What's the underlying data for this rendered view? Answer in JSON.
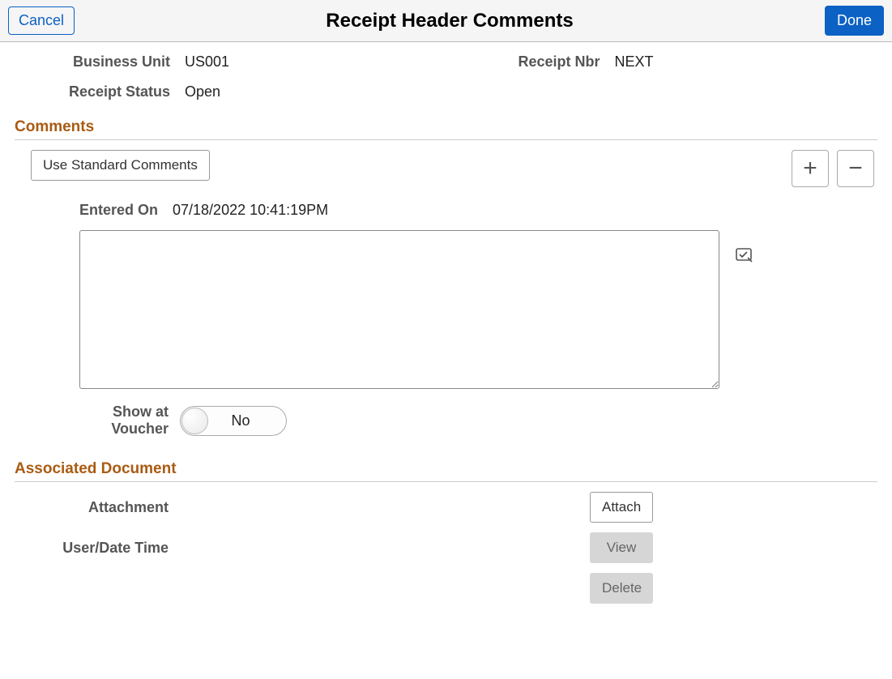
{
  "header": {
    "cancel_label": "Cancel",
    "title": "Receipt Header Comments",
    "done_label": "Done"
  },
  "info": {
    "business_unit_label": "Business Unit",
    "business_unit_value": "US001",
    "receipt_nbr_label": "Receipt Nbr",
    "receipt_nbr_value": "NEXT",
    "receipt_status_label": "Receipt Status",
    "receipt_status_value": "Open"
  },
  "comments_section": {
    "title": "Comments",
    "use_standard_label": "Use Standard Comments",
    "entered_on_label": "Entered On",
    "entered_on_value": "07/18/2022 10:41:19PM",
    "textarea_value": "",
    "show_at_voucher_label": "Show at Voucher",
    "show_at_voucher_state": "No"
  },
  "associated_section": {
    "title": "Associated Document",
    "attachment_label": "Attachment",
    "attachment_value": "",
    "user_date_label": "User/Date Time",
    "user_date_value": "",
    "attach_btn": "Attach",
    "view_btn": "View",
    "delete_btn": "Delete"
  }
}
